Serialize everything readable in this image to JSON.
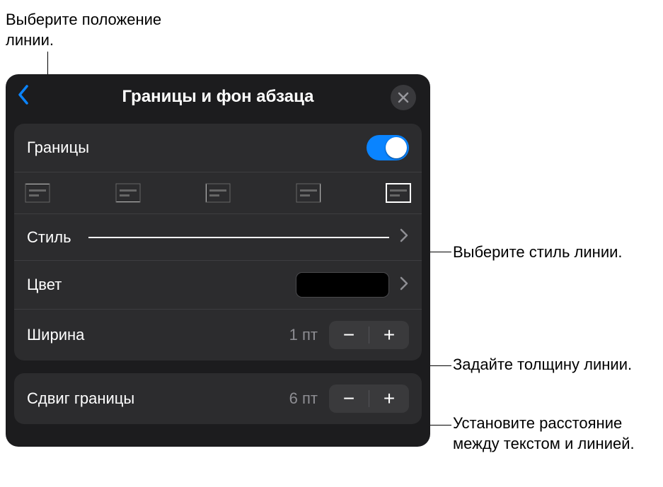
{
  "callouts": {
    "line_position": "Выберите положение линии.",
    "line_style": "Выберите стиль линии.",
    "line_width": "Задайте толщину линии.",
    "line_offset": "Установите расстояние между текстом и линией."
  },
  "panel": {
    "title": "Границы и фон абзаца",
    "borders_label": "Границы",
    "borders_on": true,
    "style_label": "Стиль",
    "color_label": "Цвет",
    "color_value": "#000000",
    "width_label": "Ширина",
    "width_value": "1 пт",
    "offset_label": "Сдвиг границы",
    "offset_value": "6 пт",
    "stepper_minus": "−",
    "stepper_plus": "+"
  },
  "position_options": [
    "top",
    "bottom",
    "left",
    "right",
    "all"
  ]
}
